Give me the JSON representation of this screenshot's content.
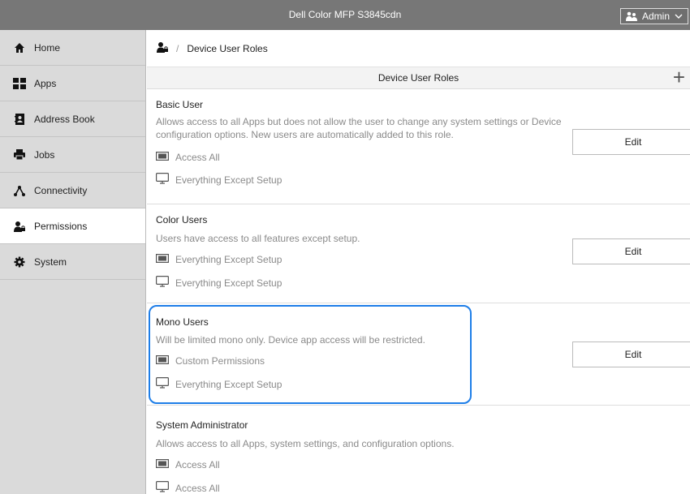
{
  "app": {
    "title": "Dell Color MFP S3845cdn",
    "user_label": "Admin"
  },
  "sidebar": {
    "items": [
      {
        "label": "Home",
        "icon": "home-icon"
      },
      {
        "label": "Apps",
        "icon": "apps-icon"
      },
      {
        "label": "Address Book",
        "icon": "address-book-icon"
      },
      {
        "label": "Jobs",
        "icon": "jobs-icon"
      },
      {
        "label": "Connectivity",
        "icon": "connectivity-icon"
      },
      {
        "label": "Permissions",
        "icon": "permissions-icon",
        "active": true
      },
      {
        "label": "System",
        "icon": "system-icon"
      }
    ]
  },
  "breadcrumb": {
    "separator": "/",
    "current": "Device User Roles"
  },
  "section": {
    "title": "Device User Roles",
    "add_label": "+"
  },
  "roles": [
    {
      "name": "Basic User",
      "description": "Allows access to all Apps but does not allow the user to change any system settings or Device configuration options. New users are automatically added to this role.",
      "device_permission": "Access All",
      "web_permission": "Everything Except Setup",
      "edit_label": "Edit"
    },
    {
      "name": "Color Users",
      "description": "Users have access to all features except setup.",
      "device_permission": "Everything Except Setup",
      "web_permission": "Everything Except Setup",
      "edit_label": "Edit"
    },
    {
      "name": "Mono Users",
      "description": "Will be limited mono only. Device app access will be restricted.",
      "device_permission": "Custom Permissions",
      "web_permission": "Everything Except Setup",
      "edit_label": "Edit",
      "highlighted": true
    },
    {
      "name": "System Administrator",
      "description": "Allows access to all Apps, system settings, and configuration options.",
      "device_permission": "Access All",
      "web_permission": "Access All"
    }
  ],
  "colors": {
    "topbar": "#777777",
    "sidebar": "#dadada",
    "highlight": "#1e7ee8"
  }
}
